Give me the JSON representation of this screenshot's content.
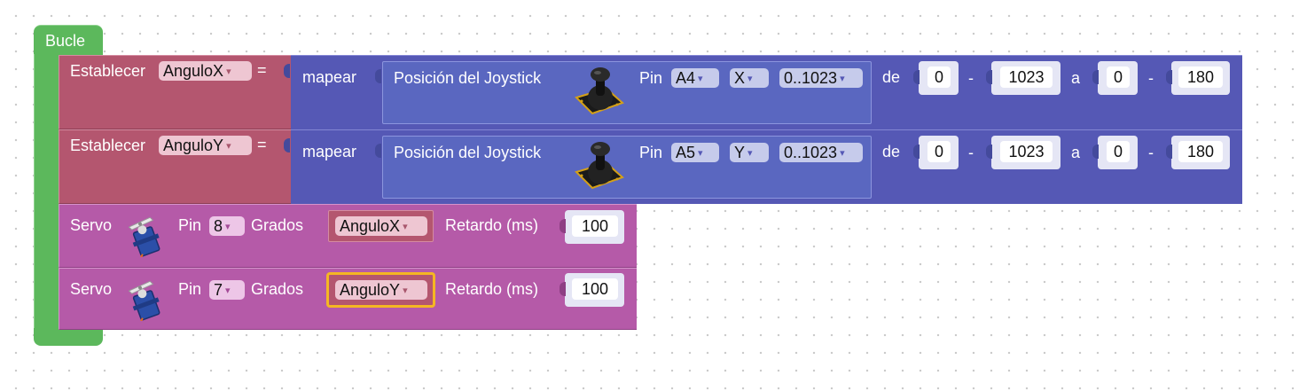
{
  "loop": {
    "label": "Bucle"
  },
  "set_blocks": [
    {
      "label": "Establecer",
      "variable": "AnguloX",
      "equals": "=",
      "map_label": "mapear",
      "joystick": {
        "label": "Posición del Joystick",
        "pin_label": "Pin",
        "pin": "A4",
        "axis": "X",
        "range": "0..1023"
      },
      "de_label": "de",
      "from_low": "0",
      "dash1": "-",
      "from_high": "1023",
      "a_label": "a",
      "to_low": "0",
      "dash2": "-",
      "to_high": "180"
    },
    {
      "label": "Establecer",
      "variable": "AnguloY",
      "equals": "=",
      "map_label": "mapear",
      "joystick": {
        "label": "Posición del Joystick",
        "pin_label": "Pin",
        "pin": "A5",
        "axis": "Y",
        "range": "0..1023"
      },
      "de_label": "de",
      "from_low": "0",
      "dash1": "-",
      "from_high": "1023",
      "a_label": "a",
      "to_low": "0",
      "dash2": "-",
      "to_high": "180"
    }
  ],
  "servo_blocks": [
    {
      "label": "Servo",
      "pin_label": "Pin",
      "pin": "8",
      "degrees_label": "Grados",
      "variable": "AnguloX",
      "delay_label": "Retardo (ms)",
      "delay": "100"
    },
    {
      "label": "Servo",
      "pin_label": "Pin",
      "pin": "7",
      "degrees_label": "Grados",
      "variable": "AnguloY",
      "delay_label": "Retardo (ms)",
      "delay": "100"
    }
  ],
  "dropdown_arrow": "▾",
  "icons": {
    "joystick": "joystick-module-icon",
    "servo": "servo-motor-icon"
  },
  "colors": {
    "loop": "#5cb85c",
    "set": "#b4566f",
    "map": "#5558b5",
    "joystick": "#5a67c0",
    "servo": "#b55aa8",
    "selection": "#f5b623"
  }
}
